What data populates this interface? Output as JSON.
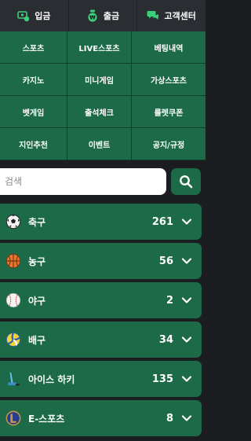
{
  "topbar": {
    "deposit_label": "입금",
    "withdraw_label": "출금",
    "support_label": "고객센터"
  },
  "menu": [
    "스포츠",
    "LIVE스포츠",
    "베팅내역",
    "카지노",
    "미니게임",
    "가상스포츠",
    "벳게임",
    "출석체크",
    "룰렛쿠폰",
    "지인추천",
    "이벤트",
    "공지/규정"
  ],
  "search": {
    "placeholder": "검색",
    "value": ""
  },
  "sports": [
    {
      "name": "축구",
      "count": "261",
      "icon": "soccer-ball-icon"
    },
    {
      "name": "농구",
      "count": "56",
      "icon": "basketball-icon"
    },
    {
      "name": "야구",
      "count": "2",
      "icon": "baseball-icon"
    },
    {
      "name": "배구",
      "count": "34",
      "icon": "volleyball-icon"
    },
    {
      "name": "아이스 하키",
      "count": "135",
      "icon": "ice-hockey-icon"
    },
    {
      "name": "E-스포츠",
      "count": "8",
      "icon": "esports-icon"
    }
  ],
  "colors": {
    "accent_green": "#1d6a48",
    "background": "#1c1d20",
    "topbar": "#2a2d31",
    "icon_green": "#3ad07a"
  }
}
